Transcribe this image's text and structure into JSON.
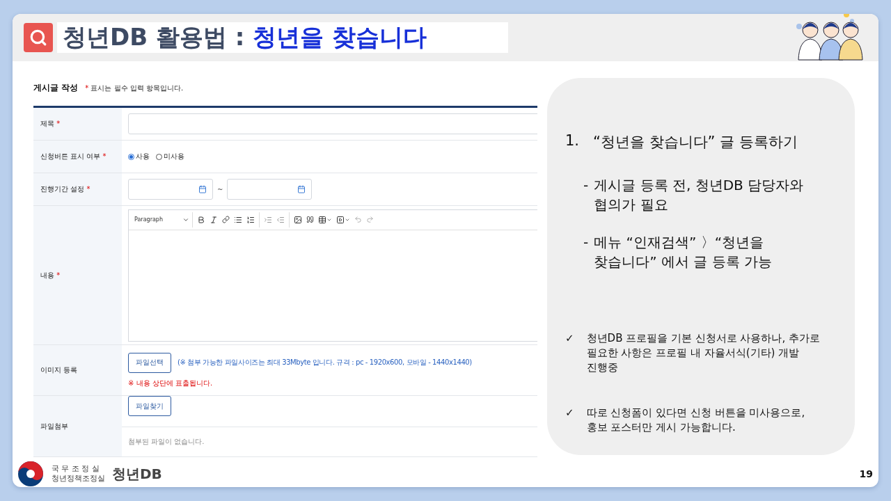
{
  "header": {
    "title_main": "청년DB 활용법 : ",
    "title_highlight": "청년을 찾습니다"
  },
  "form": {
    "heading": "게시글 작성",
    "note_mark": "*",
    "note": "표시는 필수 입력 항목입니다.",
    "fields": [
      {
        "kind": "text",
        "label": "제목",
        "required_mark": "*"
      },
      {
        "kind": "radio",
        "label": "신청버튼 표시 여부",
        "required_mark": "*",
        "options": [
          {
            "label": "사용",
            "selected": true
          },
          {
            "label": "미사용",
            "selected": false
          }
        ]
      },
      {
        "kind": "daterange",
        "label": "진행기간 설정",
        "required_mark": "*",
        "separator": "~"
      },
      {
        "kind": "editor",
        "label": "내용",
        "required_mark": "*",
        "format": "Paragraph"
      },
      {
        "kind": "image",
        "label": "이미지 등록",
        "button": "파일선택",
        "hint": "(※ 첨부 가능한 파일사이즈는 최대 33Mbyte 입니다. 규격 : pc - 1920x600, 모바일 - 1440x1440)",
        "warning": "※ 내용 상단에 표출됩니다."
      },
      {
        "kind": "file",
        "label": "파일첨부",
        "button": "파일찾기",
        "empty": "첨부된 파일이 없습니다."
      }
    ]
  },
  "guide": {
    "number": "1.",
    "title": "“청년을 찾습니다” 글 등록하기",
    "steps": [
      {
        "dash": "-",
        "lines": [
          "게시글 등록 전, 청년DB 담당자와",
          "협의가 필요"
        ]
      },
      {
        "dash": "-",
        "lines": [
          "메뉴 “인재검색” 〉“청년을",
          "찾습니다” 에서 글 등록 가능"
        ]
      }
    ],
    "notes": [
      {
        "mark": "✓",
        "lines": [
          "청년DB 프로필을 기본 신청서로 사용하나, 추가로",
          "필요한 사항은 프로필 내 자율서식(기타) 개발",
          "진행중"
        ]
      },
      {
        "mark": "✓",
        "lines": [
          "따로 신청폼이 있다면 신청 버튼을 미사용으로,",
          "홍보 포스터만 게시 가능합니다."
        ]
      }
    ]
  },
  "footer": {
    "org_top": "국 무 조 정 실",
    "org_bottom": "청년정책조정실",
    "brand": "청년DB",
    "page": "19"
  }
}
